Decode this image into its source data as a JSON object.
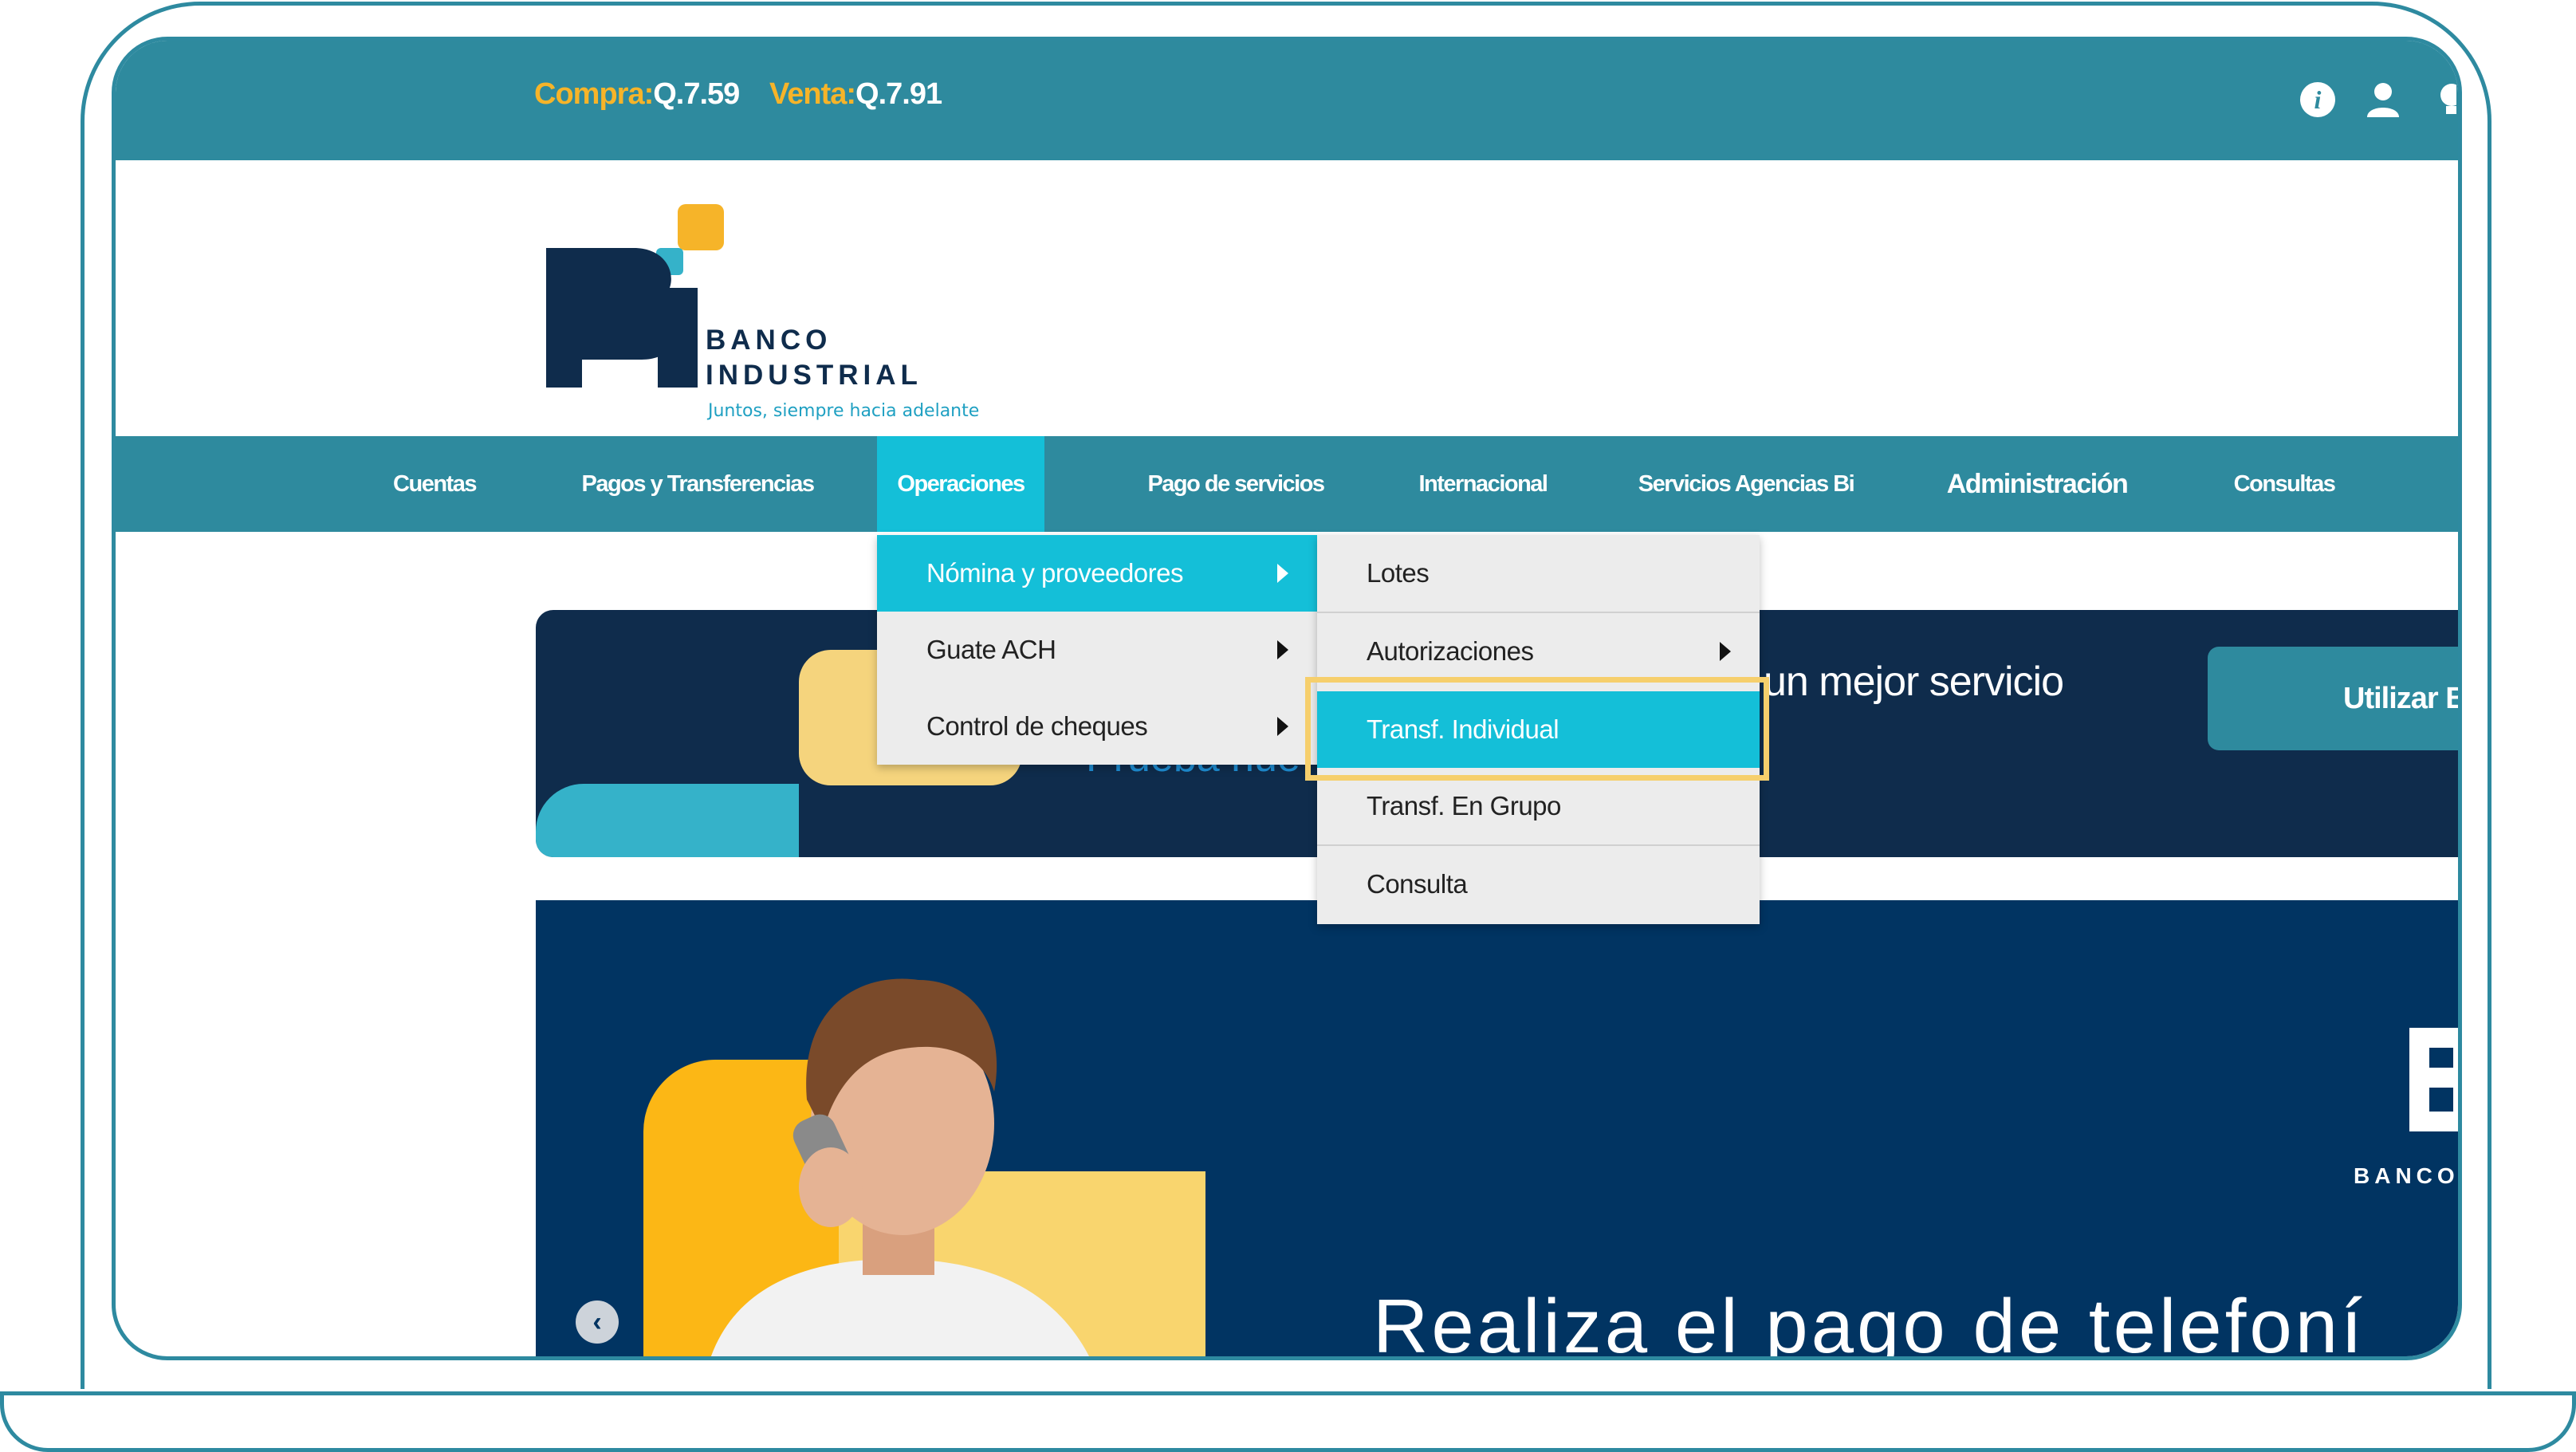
{
  "exchange": {
    "buy_label": "Compra:",
    "buy_value": "Q.7.59",
    "sell_label": "Venta:",
    "sell_value": "Q.7.91"
  },
  "brand": {
    "name_line1": "BANCO",
    "name_line2": "INDUSTRIAL",
    "tagline": "Juntos, siempre hacia adelante",
    "colors": {
      "navy": "#0f2c4c",
      "teal": "#2e8a9e",
      "cyan": "#14bfd8",
      "orange": "#f6b429"
    }
  },
  "topbar_icons": [
    "info-icon",
    "user-icon",
    "lightbulb-icon"
  ],
  "nav": {
    "items": [
      {
        "label": "Cuentas"
      },
      {
        "label": "Pagos y Transferencias"
      },
      {
        "label": "Operaciones"
      },
      {
        "label": "Pago de servicios"
      },
      {
        "label": "Internacional"
      },
      {
        "label": "Servicios Agencias Bi"
      },
      {
        "label": "Administración"
      },
      {
        "label": "Consultas"
      }
    ]
  },
  "menu_operaciones": {
    "items": [
      {
        "label": "Nómina y proveedores"
      },
      {
        "label": "Guate ACH"
      },
      {
        "label": "Control de cheques"
      }
    ]
  },
  "menu_nomina": {
    "items": [
      {
        "label": "Lotes"
      },
      {
        "label": "Autorizaciones"
      },
      {
        "label": "Transf. Individual"
      },
      {
        "label": "Transf. En Grupo"
      },
      {
        "label": "Consulta"
      }
    ]
  },
  "banner1": {
    "text": "un mejor servicio",
    "sub": "Prueba nue",
    "button": "Utilizar B"
  },
  "banner2": {
    "caption": "Realiza el pago de telefoní",
    "logo_label": "BANCO II",
    "prev_arrow": "‹"
  }
}
